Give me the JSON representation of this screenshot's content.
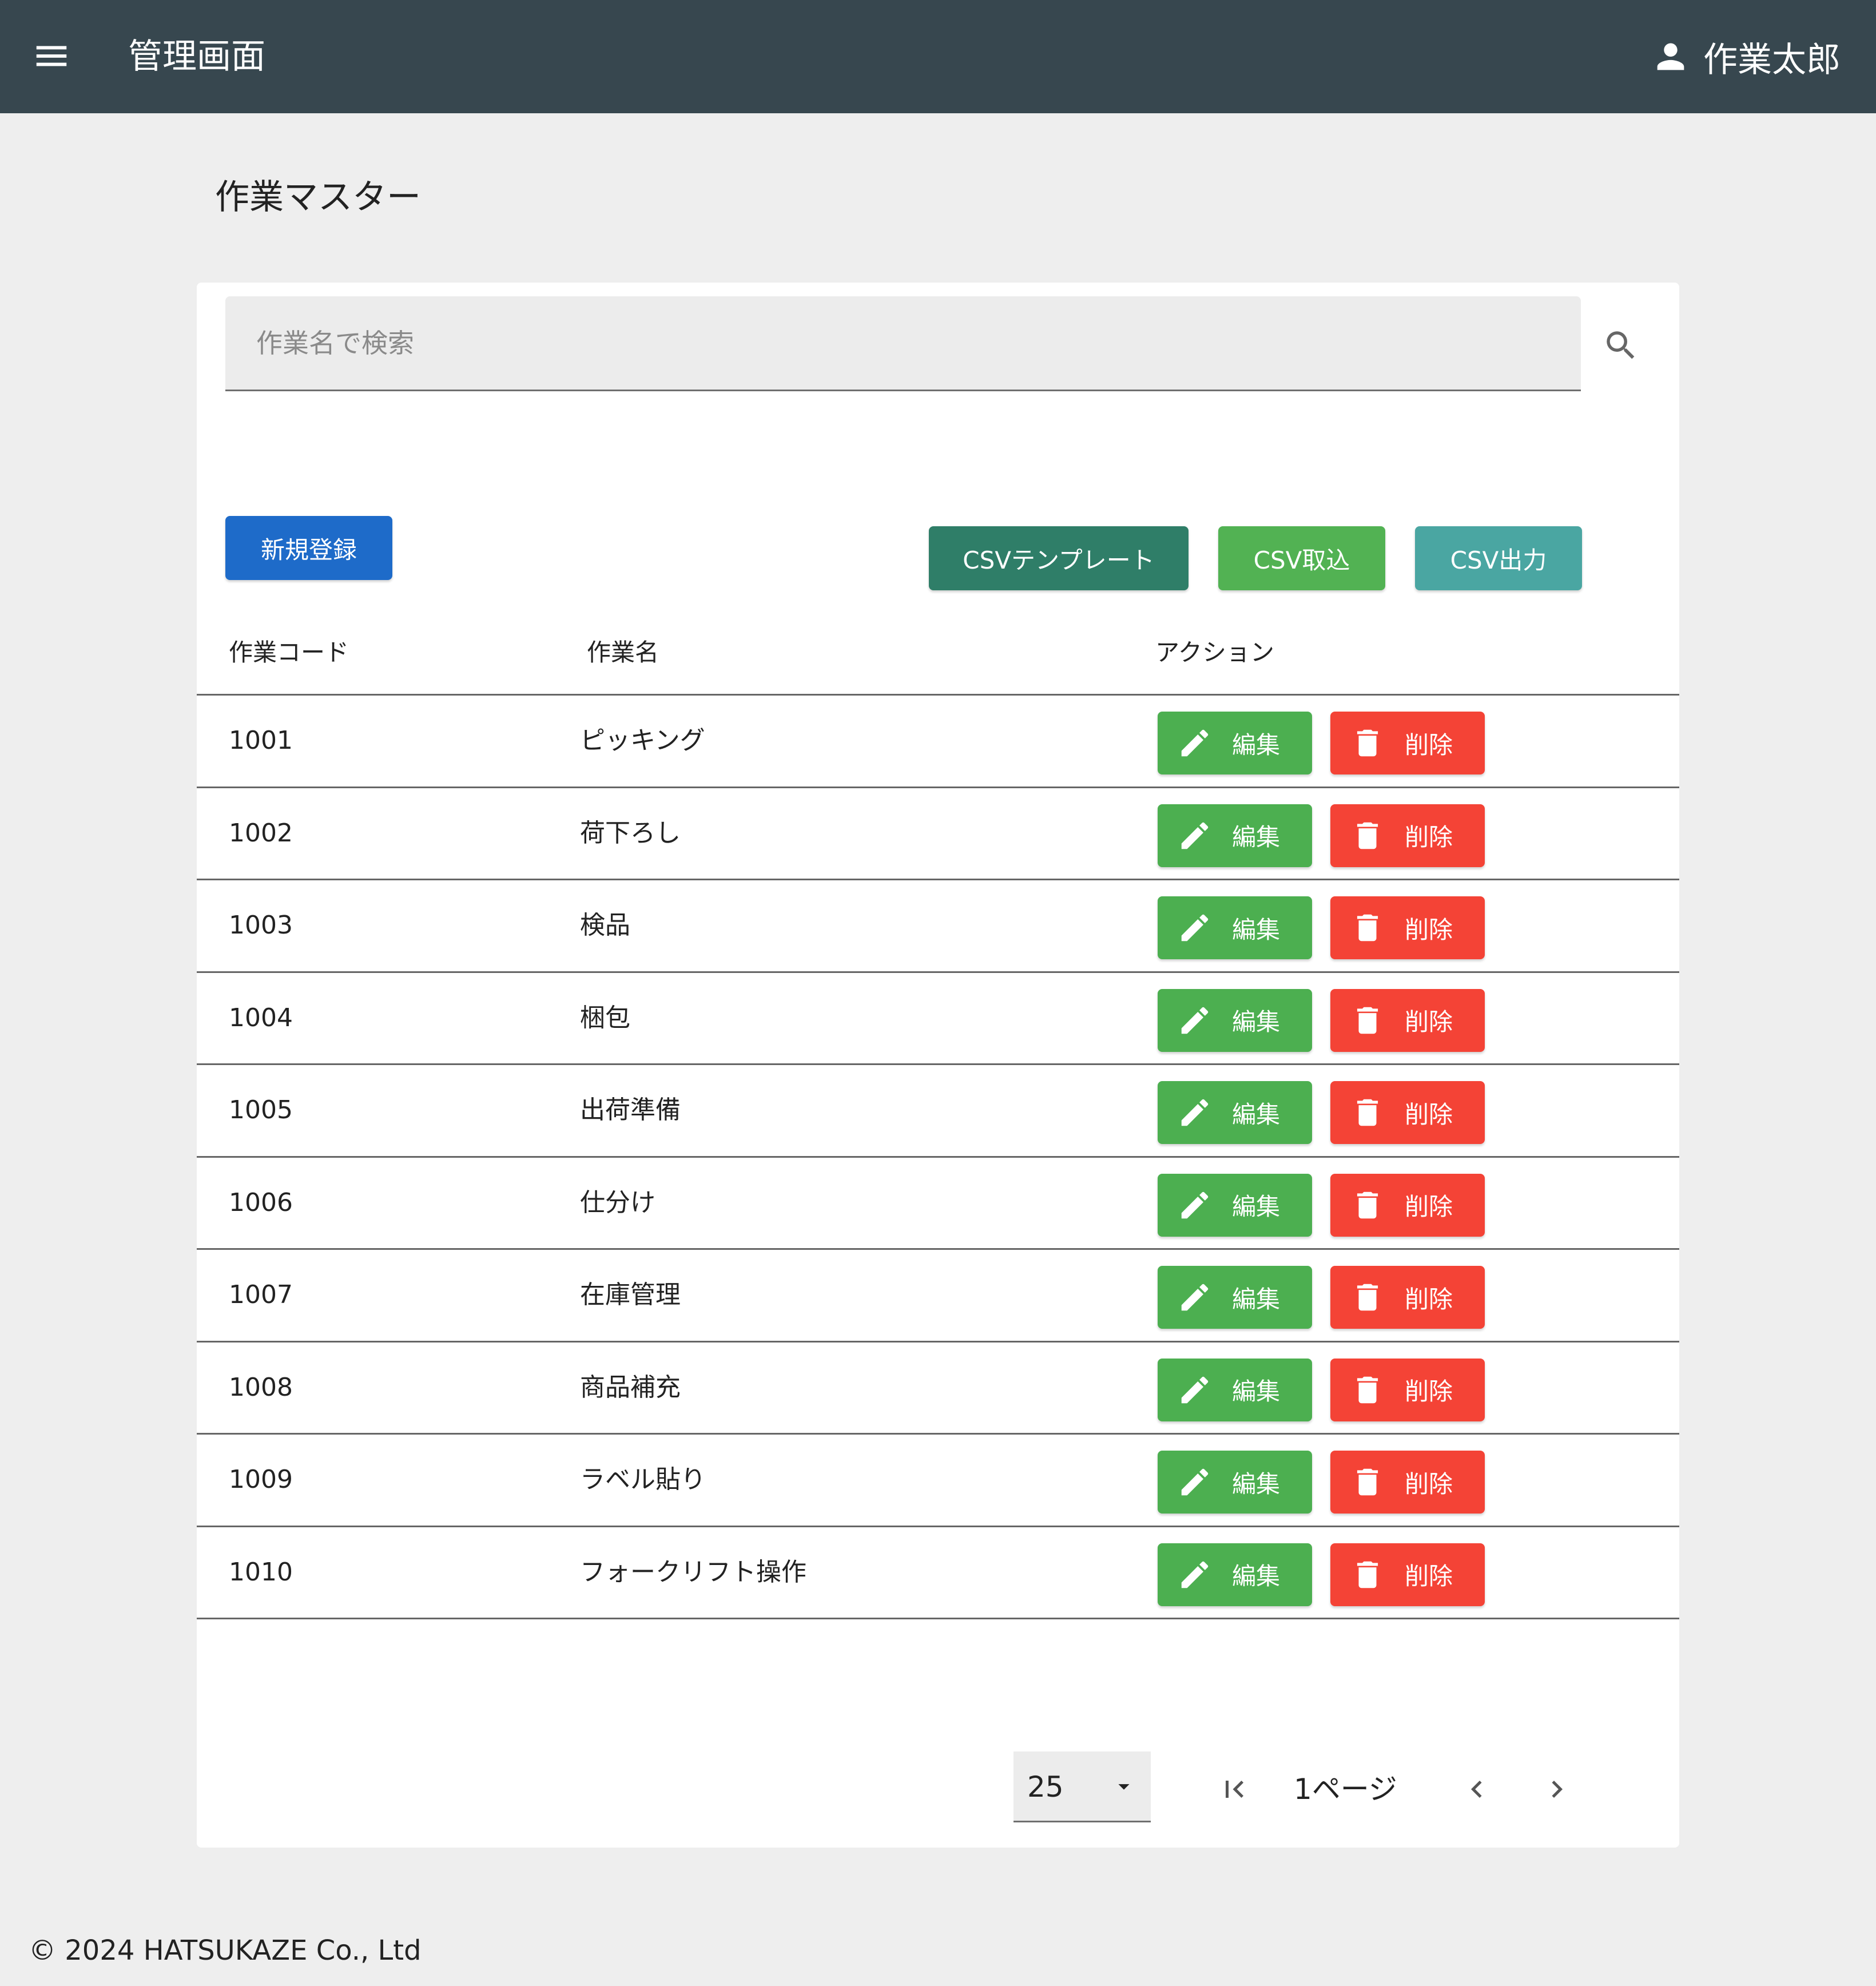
{
  "header": {
    "menu_icon": "hamburger-menu-icon",
    "title": "管理画面",
    "user_icon": "person-icon",
    "user_name": "作業太郎"
  },
  "page": {
    "title": "作業マスター"
  },
  "search": {
    "placeholder": "作業名で検索",
    "value": "",
    "icon": "search-icon"
  },
  "toolbar": {
    "new_label": "新規登録",
    "csv_template_label": "CSVテンプレート",
    "csv_import_label": "CSV取込",
    "csv_export_label": "CSV出力"
  },
  "table": {
    "headers": [
      "作業コード",
      "作業名",
      "アクション"
    ],
    "edit_label": "編集",
    "delete_label": "削除",
    "edit_icon": "pencil-icon",
    "delete_icon": "trash-icon",
    "rows": [
      {
        "code": "1001",
        "name": "ピッキング"
      },
      {
        "code": "1002",
        "name": "荷下ろし"
      },
      {
        "code": "1003",
        "name": "検品"
      },
      {
        "code": "1004",
        "name": "梱包"
      },
      {
        "code": "1005",
        "name": "出荷準備"
      },
      {
        "code": "1006",
        "name": "仕分け"
      },
      {
        "code": "1007",
        "name": "在庫管理"
      },
      {
        "code": "1008",
        "name": "商品補充"
      },
      {
        "code": "1009",
        "name": "ラベル貼り"
      },
      {
        "code": "1010",
        "name": "フォークリフト操作"
      }
    ]
  },
  "pagination": {
    "page_size": "25",
    "page_label": "1ページ",
    "first_icon": "first-page-icon",
    "prev_icon": "chevron-left-icon",
    "next_icon": "chevron-right-icon",
    "dropdown_icon": "dropdown-arrow-icon"
  },
  "footer": {
    "copyright": "© 2024 HATSUKAZE Co., Ltd"
  },
  "colors": {
    "appbar": "#37474f",
    "background": "#eeeeee",
    "primary": "#1e6bc9",
    "csv_template": "#2f7e68",
    "csv_import": "#52b253",
    "csv_export": "#4aa6a2",
    "edit": "#4caf50",
    "delete": "#f44336"
  }
}
